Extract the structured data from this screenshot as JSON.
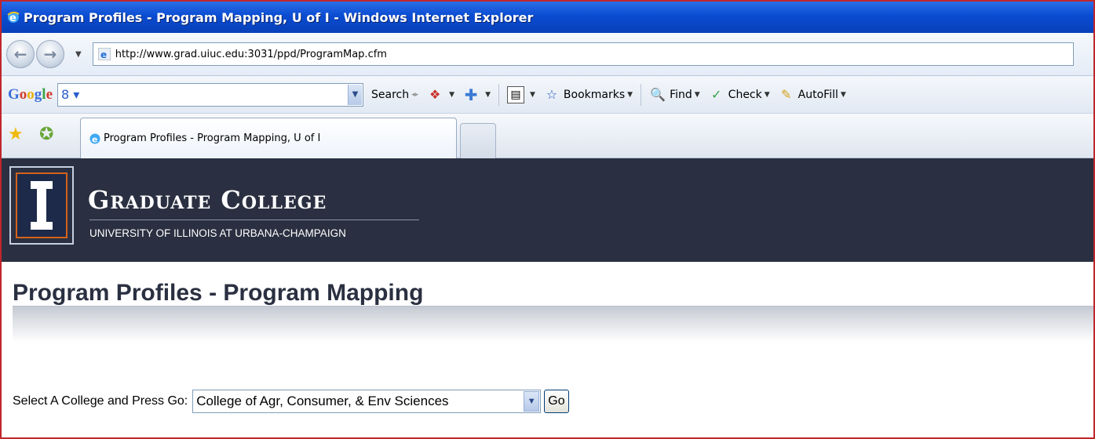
{
  "window": {
    "title": "Program Profiles - Program Mapping, U of I - Windows Internet Explorer"
  },
  "address_bar": {
    "url": "http://www.grad.uiuc.edu:3031/ppd/ProgramMap.cfm"
  },
  "google_toolbar": {
    "logo": "Google",
    "search_value": "",
    "search_label": "Search",
    "bookmarks_label": "Bookmarks",
    "find_label": "Find",
    "check_label": "Check",
    "autofill_label": "AutoFill"
  },
  "tabs": [
    {
      "label": "Program Profiles - Program Mapping, U of I",
      "active": true
    }
  ],
  "banner": {
    "name": "Graduate College",
    "university": "UNIVERSITY OF ILLINOIS AT URBANA-CHAMPAIGN"
  },
  "page": {
    "title": "Program Profiles - Program Mapping",
    "select_label": "Select A College and Press Go:",
    "selected_college": "College of Agr, Consumer, & Env Sciences",
    "go_label": "Go"
  },
  "colors": {
    "banner_bg": "#2a3041",
    "accent_orange": "#d4621c",
    "title_text": "#2a3041",
    "window_border": "#c0262c"
  }
}
